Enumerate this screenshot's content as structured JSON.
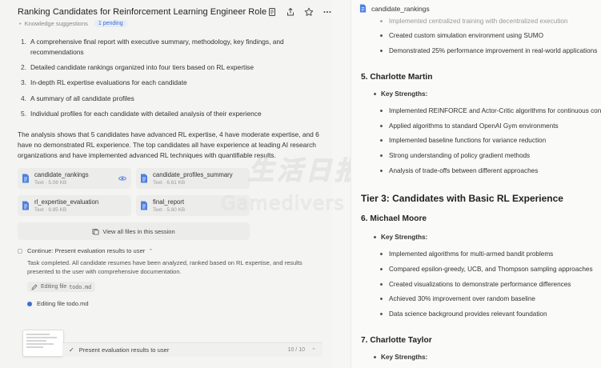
{
  "header": {
    "title": "Ranking Candidates for Reinforcement Learning Engineer Role",
    "icons": [
      "document-icon",
      "share-icon",
      "star-icon",
      "more-icon"
    ]
  },
  "knowledge": {
    "label": "Knowledge suggestions",
    "badge": "1 pending"
  },
  "summary_list": [
    {
      "num": "1.",
      "text": "A comprehensive final report with executive summary, methodology, key findings, and recommendations"
    },
    {
      "num": "2.",
      "text": "Detailed candidate rankings organized into four tiers based on RL expertise"
    },
    {
      "num": "3.",
      "text": "In-depth RL expertise evaluations for each candidate"
    },
    {
      "num": "4.",
      "text": "A summary of all candidate profiles"
    },
    {
      "num": "5.",
      "text": "Individual profiles for each candidate with detailed analysis of their experience"
    }
  ],
  "analysis": "The analysis shows that 5 candidates have advanced RL expertise, 4 have moderate expertise, and 6 have no demonstrated RL experience. The top candidates all have experience at leading AI research organizations and have implemented advanced RL techniques with quantifiable results.",
  "files": [
    {
      "name": "candidate_rankings",
      "meta": "Text · 5.08 KB"
    },
    {
      "name": "candidate_profiles_summary",
      "meta": "Text · 6.61 KB"
    },
    {
      "name": "rl_expertise_evaluation",
      "meta": "Text · 9.85 KB"
    },
    {
      "name": "final_report",
      "meta": "Text · 5.60 KB"
    }
  ],
  "view_all": "View all files in this session",
  "task": {
    "continue_label": "Continue: Present evaluation results to user",
    "completed_text": "Task completed. All candidate resumes have been analyzed, ranked based on RL expertise, and results presented to the user with comprehensive documentation.",
    "edit_chip_label": "Editing file",
    "edit_chip_file": "todo.md",
    "editing_label": "Editing file todo.md"
  },
  "progress": {
    "label": "Present evaluation results to user",
    "count": "10 / 10"
  },
  "watermark": {
    "line1": "生活日报",
    "line2": "Gamedivers"
  },
  "right": {
    "file_title": "candidate_rankings",
    "top_bullets": [
      "Implemented centralized training with decentralized execution",
      "Created custom simulation environment using SUMO",
      "Demonstrated 25% performance improvement in real-world applications"
    ],
    "c5": {
      "heading": "5. Charlotte Martin",
      "key_label": "Key Strengths:",
      "bullets": [
        "Implemented REINFORCE and Actor-Critic algorithms for continuous control",
        "Applied algorithms to standard OpenAI Gym environments",
        "Implemented baseline functions for variance reduction",
        "Strong understanding of policy gradient methods",
        "Analysis of trade-offs between different approaches"
      ]
    },
    "tier3": "Tier 3: Candidates with Basic RL Experience",
    "c6": {
      "heading": "6. Michael Moore",
      "key_label": "Key Strengths:",
      "bullets": [
        "Implemented algorithms for multi-armed bandit problems",
        "Compared epsilon-greedy, UCB, and Thompson sampling approaches",
        "Created visualizations to demonstrate performance differences",
        "Achieved 30% improvement over random baseline",
        "Data science background provides relevant foundation"
      ]
    },
    "c7": {
      "heading": "7. Charlotte Taylor",
      "key_label": "Key Strengths:"
    }
  },
  "colors": {
    "accent": "#3b6fd6",
    "file_icon": "#4f7fe0"
  }
}
